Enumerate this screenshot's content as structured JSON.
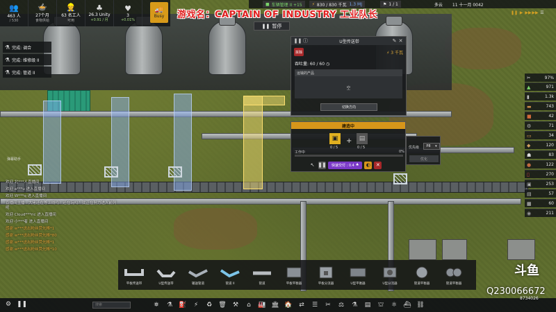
{
  "resources": [
    {
      "value": "463 人",
      "sub": "/ 530",
      "icon": "people-icon",
      "glyph": "👥"
    },
    {
      "value": "27个月",
      "sub": "食物供给",
      "icon": "food-icon",
      "glyph": "🍲"
    },
    {
      "value": "63 名工人",
      "sub": "可用",
      "icon": "worker-icon",
      "glyph": "👷"
    },
    {
      "value": "26.3 Unity",
      "sub": "+0.91 / 月",
      "icon": "unity-icon",
      "glyph": "♣"
    },
    {
      "value": "3",
      "sub": "+0.01%",
      "icon": "health-icon",
      "glyph": "♥"
    }
  ],
  "busy_label": "Busy",
  "overlay_title": "游戏名：CAPTAIN OF INDUSTRY  工业队长",
  "top_right": {
    "vehicles": "车辆管理 II +15",
    "power": "830 / 830 千瓦",
    "power_extra": "1.3 MJ",
    "page": "1 / 1",
    "weather": "多云",
    "date": "11 十一月 0042"
  },
  "pause_label": "暂停",
  "notifications": [
    {
      "icon": "flask-icon",
      "text": "完成: 调合"
    },
    {
      "icon": "flask-icon",
      "text": "完成: 维修级 II"
    },
    {
      "icon": "flask-icon",
      "text": "完成: 管道 II"
    }
  ],
  "belt_window": {
    "title": "U型传送带",
    "demolish": "拆除",
    "power": "3 千瓦",
    "throughput": "吞吐量: 60 / 60",
    "products_header": "运输的产品",
    "products_empty": "空",
    "switch_direction": "切换方向"
  },
  "construction": {
    "header": "建造中",
    "mat1_count": "0 / 5",
    "mat2_count": "0 / 5",
    "work_label": "工作中",
    "work_pct": "0%",
    "work_progress": 0.0,
    "quick_deliver": "快速交付 : 0.4"
  },
  "priority": {
    "label": "优先级",
    "value": "P8",
    "button": "优化"
  },
  "inventory_header": {
    "zoom": "97%"
  },
  "inventory": [
    {
      "icon": "triangle-icon",
      "glyph": "▲",
      "value": "971",
      "color": "#7ad36a"
    },
    {
      "icon": "sack-icon",
      "glyph": "▮",
      "value": "1.3k",
      "color": "#bbbbbb"
    },
    {
      "icon": "log-icon",
      "glyph": "▬",
      "value": "743",
      "color": "#c88a4a"
    },
    {
      "icon": "brick-icon",
      "glyph": "■",
      "value": "42",
      "color": "#d06a3a"
    },
    {
      "icon": "gear-icon",
      "glyph": "⚙",
      "value": "71",
      "color": "#bbbbbb"
    },
    {
      "icon": "plank-icon",
      "glyph": "▭",
      "value": "34",
      "color": "#e0a050"
    },
    {
      "icon": "food-crate-icon",
      "glyph": "◆",
      "value": "120",
      "color": "#d0a060"
    },
    {
      "icon": "worker-icon",
      "glyph": "☗",
      "value": "83",
      "color": "#dddddd"
    },
    {
      "icon": "copper-icon",
      "glyph": "●",
      "value": "122",
      "color": "#c06a40"
    },
    {
      "icon": "bottle-icon",
      "glyph": "▯",
      "value": "270",
      "color": "#d04040"
    },
    {
      "icon": "iron-icon",
      "glyph": "▣",
      "value": "253",
      "color": "#aaaaaa"
    },
    {
      "icon": "truck-icon",
      "glyph": "▤",
      "value": "57",
      "color": "#bbbbbb"
    },
    {
      "icon": "brick-stack-icon",
      "glyph": "▦",
      "value": "60",
      "color": "#d0d0d0"
    },
    {
      "icon": "stone-icon",
      "glyph": "◉",
      "value": "211",
      "color": "#999999"
    }
  ],
  "chat_label": "弹幕助手",
  "chat": [
    {
      "text": "欢迎 北***人直播间",
      "gift": false
    },
    {
      "text": "欢迎 a***u 进入直播间",
      "gift": false
    },
    {
      "text": "欢迎 W***q 进入直播间",
      "gift": false
    },
    {
      "text": "直播间主播 : 大佬还在等上线吗？还在玩吗？我正在努力进入前列呢",
      "gift": false
    },
    {
      "text": "欢迎 Cloud***ric 进入直播间",
      "gift": false
    },
    {
      "text": "欢迎 小***者 进入直播间",
      "gift": false
    },
    {
      "text": "感谢 w***送出粉丝荧光棒*1",
      "gift": true
    },
    {
      "text": "感谢 w***送出粉丝荧光棒*80",
      "gift": true
    },
    {
      "text": "感谢 w***送出粉丝荧光棒*1",
      "gift": true
    },
    {
      "text": "感谢 w***送出粉丝荧光棒*10",
      "gift": true
    }
  ],
  "tools": [
    {
      "label": "平板传送带",
      "icon": "flat-belt-icon"
    },
    {
      "label": "U型传送带",
      "icon": "u-belt-icon"
    },
    {
      "label": "输送管道",
      "icon": "pipe-belt-icon"
    },
    {
      "label": "管道 II",
      "icon": "pipe-ii-icon"
    },
    {
      "label": "管道",
      "icon": "pipe-icon"
    },
    {
      "label": "平板平衡器",
      "icon": "flat-balancer-icon"
    },
    {
      "label": "平板分流器",
      "icon": "flat-splitter-icon"
    },
    {
      "label": "U型平衡器",
      "icon": "u-balancer-icon"
    },
    {
      "label": "U型分流器",
      "icon": "u-splitter-icon"
    },
    {
      "label": "管道平衡器",
      "icon": "pipe-balancer-icon"
    },
    {
      "label": "管道平衡器",
      "icon": "pipe-balancer-2-icon"
    }
  ],
  "search_placeholder": "搜索",
  "categories": [
    {
      "icon": "tower-icon",
      "glyph": "⛯"
    },
    {
      "icon": "flask-icon",
      "glyph": "⚗"
    },
    {
      "icon": "fuel-icon",
      "glyph": "⛽"
    },
    {
      "icon": "power-icon",
      "glyph": "⚡"
    },
    {
      "icon": "recycle-icon",
      "glyph": "♻"
    },
    {
      "icon": "bin-icon",
      "glyph": "🗑"
    },
    {
      "icon": "factory-icon",
      "glyph": "⚒"
    },
    {
      "icon": "warehouse-icon",
      "glyph": "⌂"
    },
    {
      "icon": "industry-icon",
      "glyph": "🏭"
    },
    {
      "icon": "bank-icon",
      "glyph": "🏛"
    },
    {
      "icon": "house-icon",
      "glyph": "🏠"
    },
    {
      "icon": "transport-icon",
      "glyph": "⇄"
    },
    {
      "icon": "rail-icon",
      "glyph": "☰"
    },
    {
      "icon": "tools-icon",
      "glyph": "✂"
    },
    {
      "icon": "scale-icon",
      "glyph": "⚖"
    },
    {
      "icon": "test-icon",
      "glyph": "⚗"
    },
    {
      "icon": "storage-icon",
      "glyph": "▤"
    },
    {
      "icon": "landmark-icon",
      "glyph": "⛫"
    },
    {
      "icon": "lab-icon",
      "glyph": "⚛"
    },
    {
      "icon": "ship-icon",
      "glyph": "⛴"
    },
    {
      "icon": "bridge-icon",
      "glyph": "⛓"
    }
  ],
  "watermark": {
    "logo": "斗鱼",
    "room_id": "Q230066672",
    "room_sub": "8734026"
  },
  "colors": {
    "accent_orange": "#d7961a",
    "demolish_red": "#a8282a",
    "quick_purple": "#7a39c7",
    "overlay_red": "#e02020"
  }
}
